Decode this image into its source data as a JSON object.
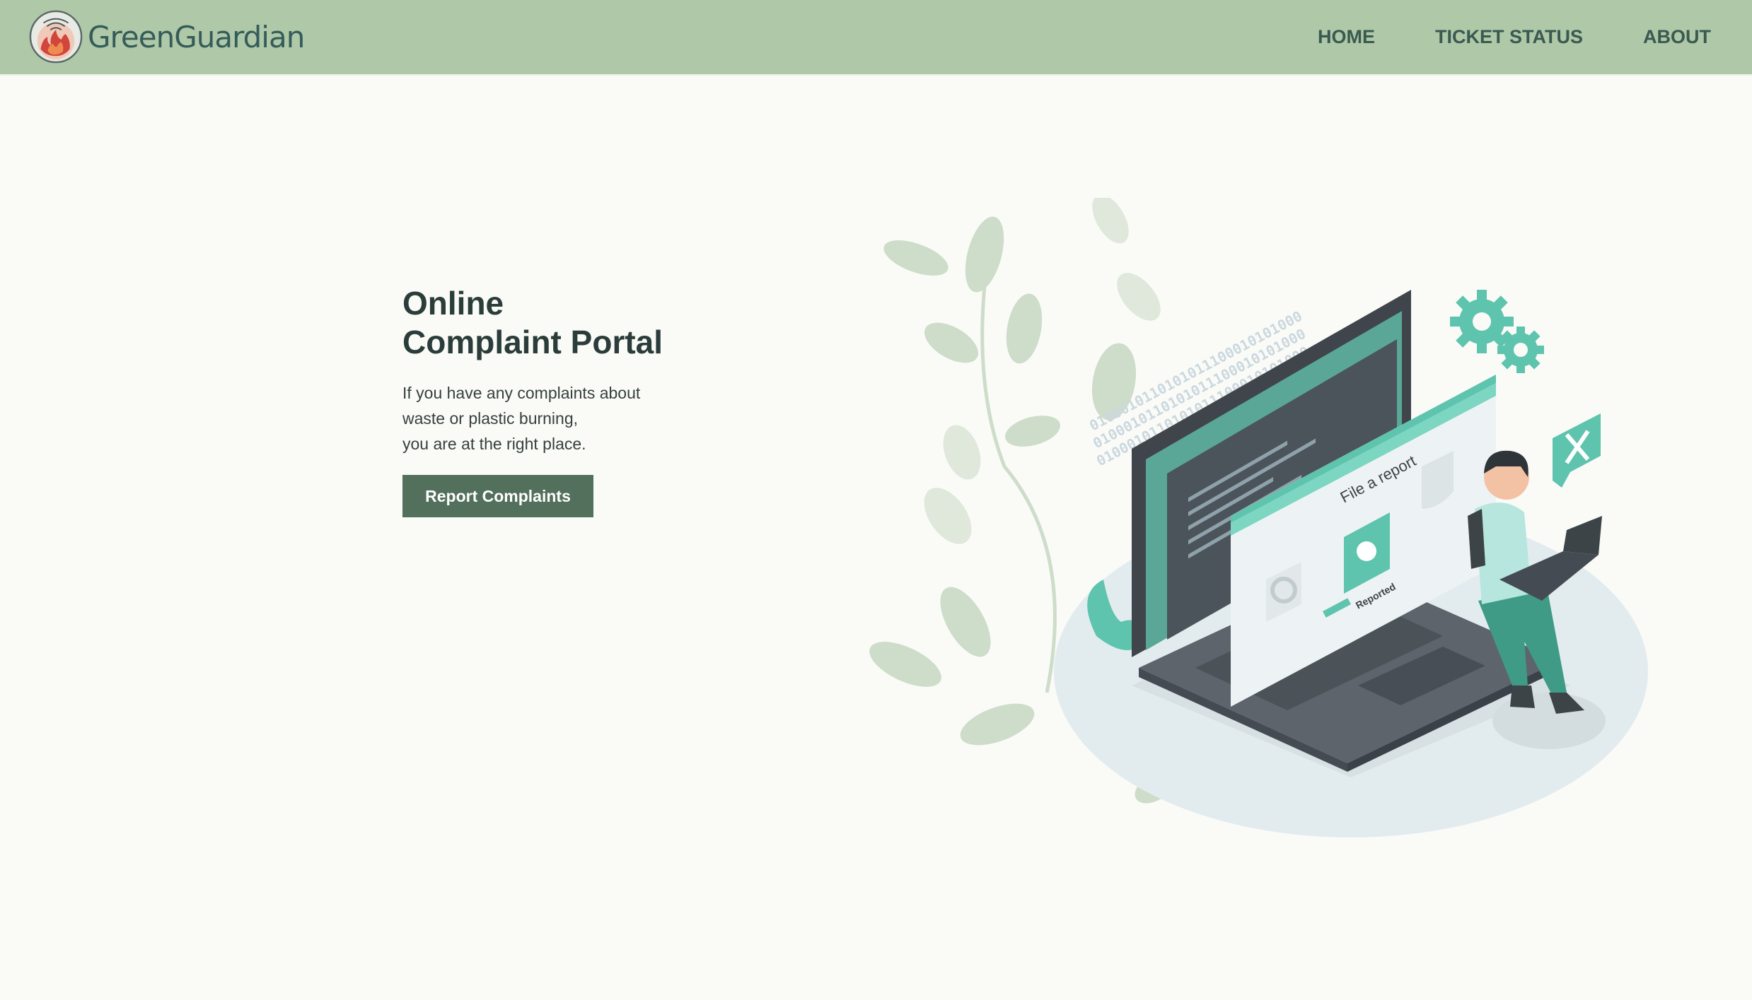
{
  "brand": {
    "name": "GreenGuardian",
    "logo_icon": "burning-fire-logo"
  },
  "nav": {
    "items": [
      {
        "label": "HOME"
      },
      {
        "label": "TICKET STATUS"
      },
      {
        "label": "ABOUT"
      }
    ]
  },
  "hero": {
    "title_line1": "Online",
    "title_line2": "Complaint Portal",
    "text_line1": "If you have any complaints about",
    "text_line2": "waste or plastic burning,",
    "text_line3": "you are at the right place.",
    "button_label": "Report Complaints"
  },
  "illustration": {
    "window_label": "File a report",
    "status_label": "Reported",
    "binary_text": "0100010110101011100010101000"
  },
  "colors": {
    "navbar": "#afc8a8",
    "brand_text": "#345c59",
    "button": "#53705c",
    "background": "#fafbf7",
    "accent": "#5ec4ae"
  }
}
